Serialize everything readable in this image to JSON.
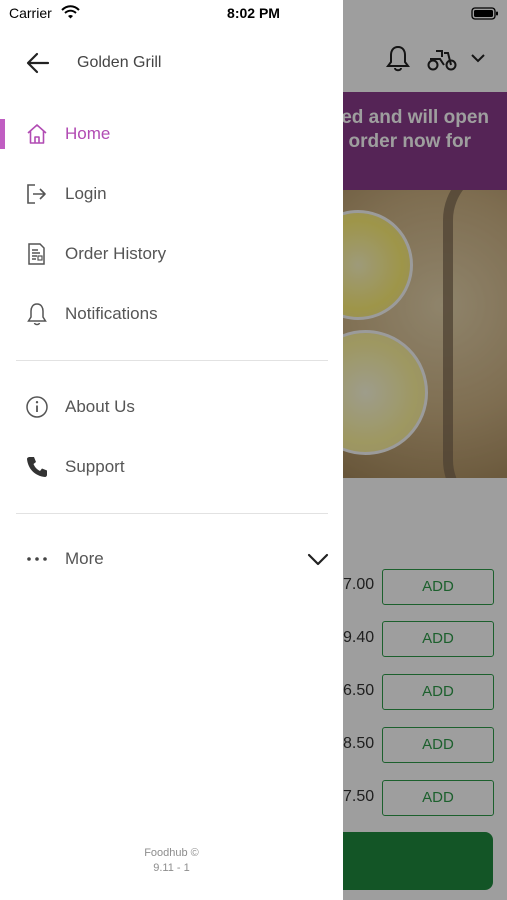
{
  "status_bar": {
    "carrier": "Carrier",
    "time": "8:02 PM"
  },
  "background": {
    "banner_line1": "ed and will open",
    "banner_line2": "order now for",
    "prices": [
      "7.00",
      "9.40",
      "6.50",
      "8.50",
      "7.50"
    ],
    "add_label": "ADD",
    "accent_purple": "#8a3b8c",
    "accent_green": "#2e9b4a"
  },
  "drawer": {
    "title": "Golden Grill",
    "items": [
      {
        "label": "Home",
        "icon": "home-icon",
        "active": true
      },
      {
        "label": "Login",
        "icon": "login-icon"
      },
      {
        "label": "Order History",
        "icon": "receipt-icon"
      },
      {
        "label": "Notifications",
        "icon": "bell-icon"
      },
      {
        "label": "About Us",
        "icon": "info-icon"
      },
      {
        "label": "Support",
        "icon": "phone-icon"
      },
      {
        "label": "More",
        "icon": "more-dots-icon"
      }
    ],
    "active_color": "#b14bb3",
    "footer_line1": "Foodhub ©",
    "footer_line2": "9.11 - 1"
  }
}
